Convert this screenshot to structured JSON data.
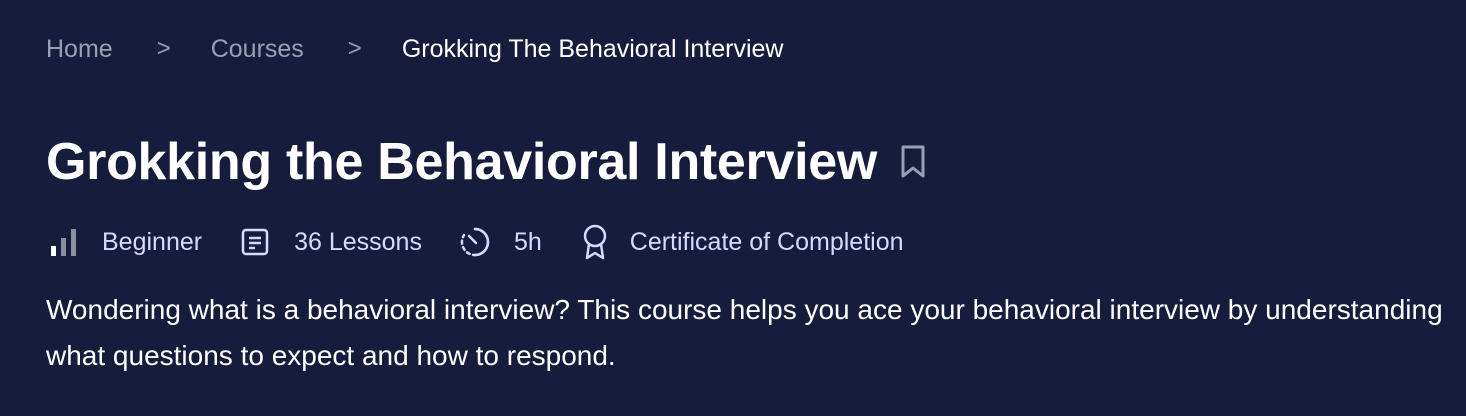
{
  "breadcrumb": {
    "home": "Home",
    "separator": ">",
    "courses": "Courses",
    "current": "Grokking The Behavioral Interview"
  },
  "course": {
    "title": "Grokking the Behavioral Interview",
    "level": "Beginner",
    "lessons": "36 Lessons",
    "duration": "5h",
    "certificate": "Certificate of Completion",
    "description": "Wondering what is a behavioral interview? This course helps you ace your behavioral interview by understanding what questions to expect and how to respond."
  },
  "icons": {
    "bookmark": "bookmark-icon",
    "level": "level-bars-icon",
    "lessons": "lessons-document-icon",
    "duration": "clock-timer-icon",
    "certificate": "award-ribbon-icon"
  },
  "colors": {
    "background": "#161c3b",
    "breadcrumb_muted": "#9aa0b4",
    "meta_text": "#d8d9ff",
    "title": "#ffffff"
  }
}
